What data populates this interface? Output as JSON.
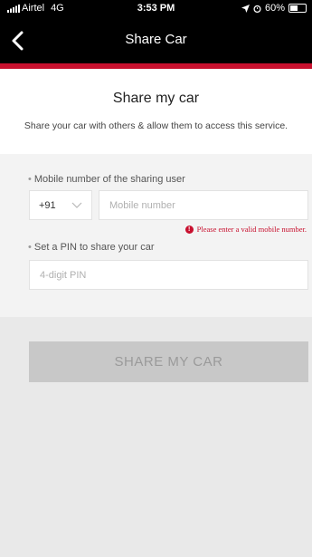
{
  "status_bar": {
    "carrier": "Airtel",
    "network": "4G",
    "time": "3:53 PM",
    "battery_percent": "60%",
    "battery_level": 0.6
  },
  "header": {
    "title": "Share Car",
    "back_icon": "chevron-left-icon"
  },
  "main": {
    "title": "Share my car",
    "subtitle": "Share your car with others & allow them to access this service."
  },
  "form": {
    "mobile_label": "Mobile number of the sharing user",
    "country_code": "+91",
    "mobile_placeholder": "Mobile number",
    "mobile_value": "",
    "error_text": "Please enter a valid mobile number.",
    "pin_label": "Set a PIN to share your car",
    "pin_placeholder": "4-digit PIN",
    "pin_value": ""
  },
  "actions": {
    "share_label": "SHARE MY CAR"
  },
  "colors": {
    "accent": "#c8102e",
    "button_disabled": "#c8c8c8",
    "header_bg": "#000000"
  }
}
